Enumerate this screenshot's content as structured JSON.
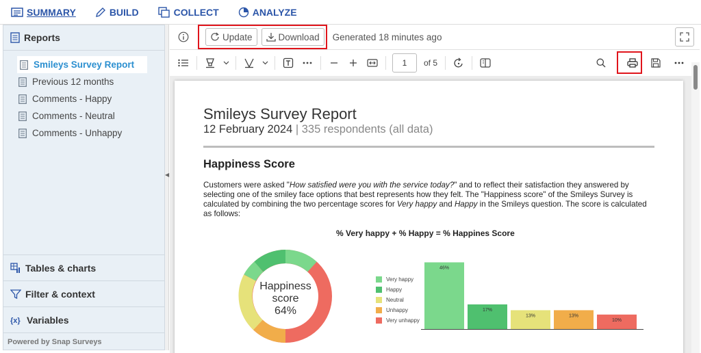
{
  "nav": {
    "summary": "SUMMARY",
    "build": "BUILD",
    "collect": "COLLECT",
    "analyze": "ANALYZE"
  },
  "sidebar": {
    "title": "Reports",
    "items": [
      {
        "label": "Smileys Survey Report"
      },
      {
        "label": "Previous 12 months"
      },
      {
        "label": "Comments - Happy"
      },
      {
        "label": "Comments - Neutral"
      },
      {
        "label": "Comments - Unhappy"
      }
    ],
    "panels": {
      "tables": "Tables & charts",
      "filter": "Filter & context",
      "variables": "Variables"
    },
    "powered": "Powered by Snap Surveys"
  },
  "reportbar": {
    "update": "Update",
    "download": "Download",
    "generated": "Generated 18 minutes ago"
  },
  "pdf": {
    "page": "1",
    "of": "of 5"
  },
  "report": {
    "title": "Smileys Survey Report",
    "date": "12 February 2024",
    "sep": " | ",
    "respondents": "335 respondents (all data)",
    "section": "Happiness Score",
    "p1": "Customers were asked \"",
    "q": "How satisfied were you with the service today?",
    "p2": "\" and to reflect their satisfaction they answered by selecting one of the smiley face options that best represents how they felt. The \"Happiness score\" of the Smileys Survey is calculated by combining the two percentage scores for ",
    "vh": "Very happy",
    "p3": " and ",
    "h": "Happy",
    "p4": " in the Smileys question. The score is calculated as follows:",
    "formula": "% Very happy + % Happy = % Happines Score",
    "ring_l1": "Happiness",
    "ring_l2": "score",
    "ring_l3": "64%"
  },
  "colors": {
    "very_happy": "#7bd88c",
    "happy": "#4fc06f",
    "neutral": "#e6e27a",
    "unhappy": "#f1ad4a",
    "very_unhappy": "#ee6b60",
    "accent": "#2b55a8",
    "highlight": "#e0141b"
  },
  "chart_data": {
    "type": "bar",
    "categories": [
      "Very happy",
      "Happy",
      "Neutral",
      "Unhappy",
      "Very unhappy"
    ],
    "values": [
      46,
      17,
      13,
      13,
      10
    ],
    "value_labels": [
      "46%",
      "17%",
      "13%",
      "13%",
      "10%"
    ],
    "legend": [
      "Very happy",
      "Happy",
      "Neutral",
      "Unhappy",
      "Very unhappy"
    ],
    "legend_position": "left",
    "ylim": [
      0,
      50
    ],
    "grid": false
  }
}
